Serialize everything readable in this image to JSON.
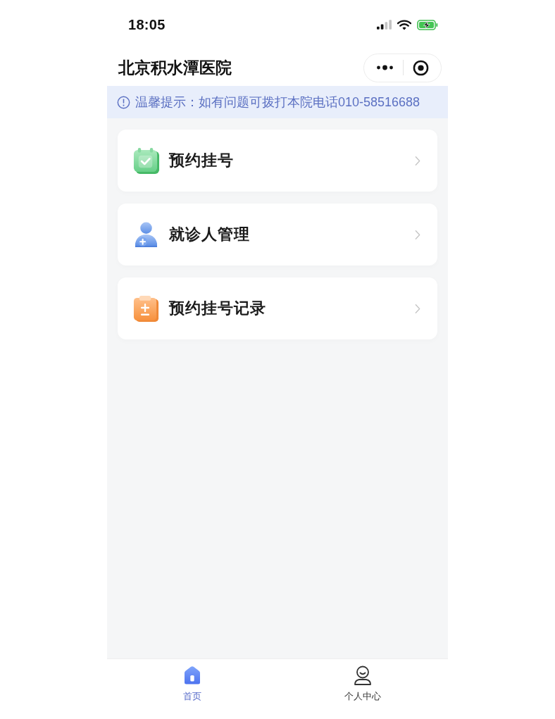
{
  "status_bar": {
    "time": "18:05"
  },
  "header": {
    "title": "北京积水潭医院"
  },
  "notice": {
    "text": "温馨提示：如有问题可拨打本院电话010-58516688"
  },
  "menu": [
    {
      "kind": "calendar",
      "label": "预约挂号"
    },
    {
      "kind": "patient",
      "label": "就诊人管理"
    },
    {
      "kind": "clipboard",
      "label": "预约挂号记录"
    }
  ],
  "tab_bar": [
    {
      "kind": "home",
      "label": "首页",
      "selected": true
    },
    {
      "kind": "person",
      "label": "个人中心",
      "selected": false
    }
  ]
}
